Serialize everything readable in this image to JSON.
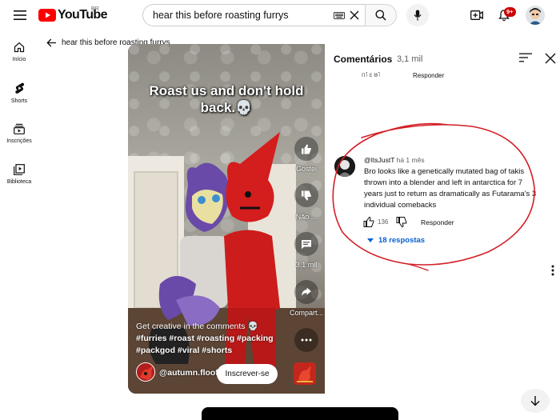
{
  "header": {
    "logo_text": "YouTube",
    "country_code": "BR",
    "search_value": "hear this before roasting furrys",
    "notification_badge": "9+"
  },
  "sidebar": {
    "items": [
      {
        "label": "Início",
        "icon": "home-icon"
      },
      {
        "label": "Shorts",
        "icon": "shorts-icon"
      },
      {
        "label": "Inscrições",
        "icon": "subscriptions-icon"
      },
      {
        "label": "Biblioteca",
        "icon": "library-icon"
      }
    ]
  },
  "back": {
    "label": "hear this before roasting furrys"
  },
  "video": {
    "overlay_title_line1": "Roast us and don't hold",
    "overlay_title_line2": "back.💀",
    "description_line1": "Get creative in the comments 💀",
    "description_tags1": "#furries #roast #roasting #packing",
    "description_tags2": "#packgod #viral #shorts",
    "channel": "@autumn.floofs",
    "subscribe_label": "Inscrever-se",
    "actions": {
      "like_label": "Gostei",
      "dislike_label": "Não ...",
      "comments_label": "3,1 mil",
      "share_label": "Compart..."
    }
  },
  "comments": {
    "title": "Comentários",
    "count": "3,1 mil",
    "previous": {
      "partial_text": "ᴨ˥ ɛ  ᵿ˥",
      "reply_label": "Responder"
    },
    "comment": {
      "author": "@ItsJustT",
      "time": "há 1 mês",
      "text": "Bro looks like a genetically mutated bag of takis thrown into a blender and left in antarctica for 7 years just to return as dramatically as Futarama's 3 individual comebacks",
      "likes": "136",
      "reply_label": "Responder",
      "replies_label": "18 respostas"
    }
  },
  "colors": {
    "brand_red": "#ff0000",
    "link_blue": "#065fd4",
    "badge_red": "#cc0000",
    "annotation_red": "#d31f26"
  }
}
